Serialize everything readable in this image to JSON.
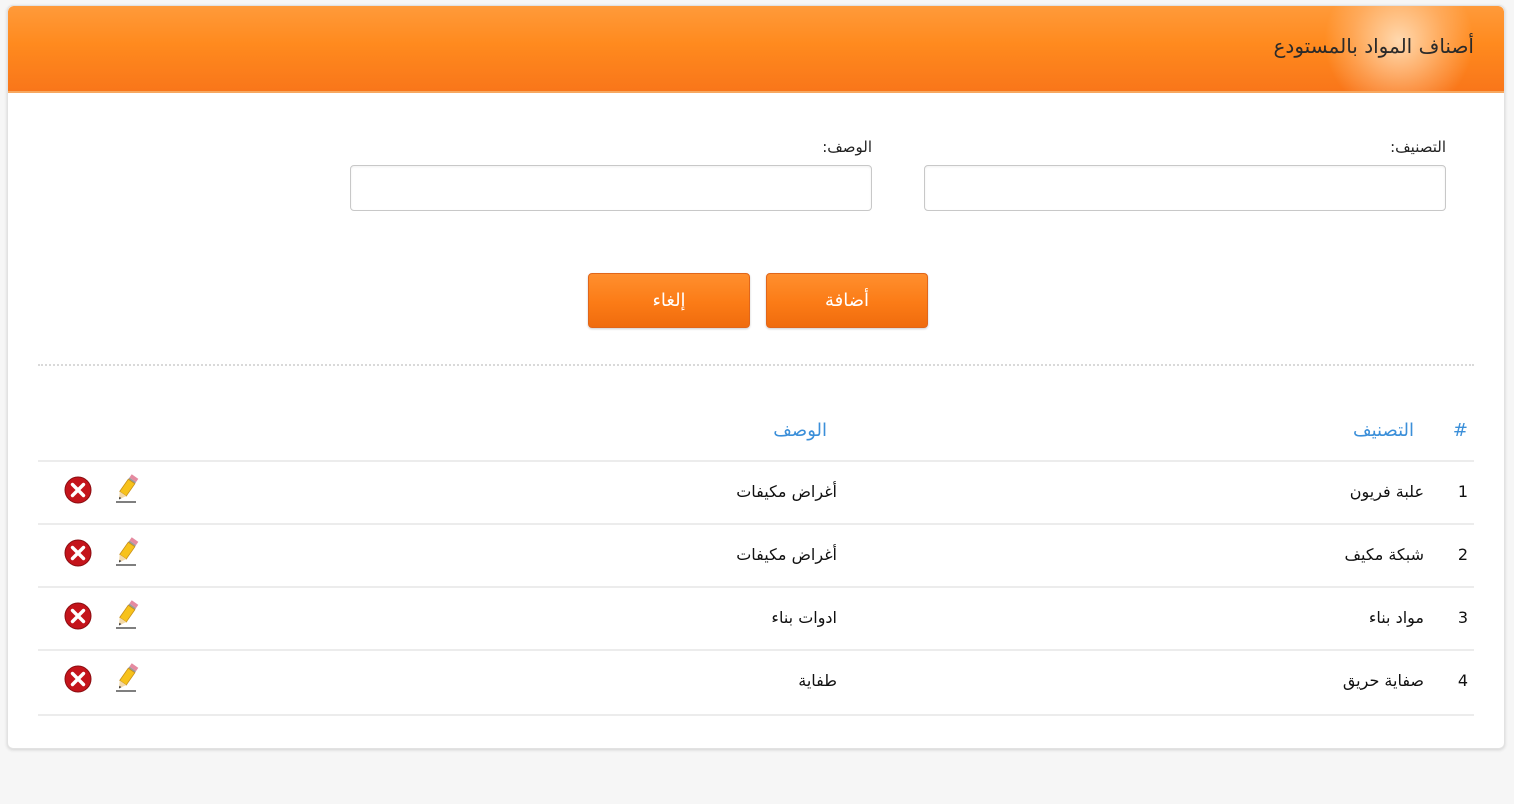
{
  "header": {
    "title": "أصناف المواد بالمستودع"
  },
  "form": {
    "category_label": "التصنيف:",
    "category_value": "",
    "description_label": "الوصف:",
    "description_value": "",
    "add_label": "أضافة",
    "cancel_label": "إلغاء"
  },
  "table": {
    "headers": {
      "number": "#",
      "category": "التصنيف",
      "description": "الوصف"
    },
    "rows": [
      {
        "number": "1",
        "category": "علبة فريون",
        "description": "أغراض مكيفات"
      },
      {
        "number": "2",
        "category": "شبكة مكيف",
        "description": "أغراض مكيفات"
      },
      {
        "number": "3",
        "category": "مواد بناء",
        "description": "ادوات بناء"
      },
      {
        "number": "4",
        "category": "صفاية حريق",
        "description": "طفاية"
      }
    ]
  },
  "icons": {
    "edit": "pencil-icon",
    "delete": "delete-icon"
  },
  "colors": {
    "header_orange": "#ff8a1e",
    "button_orange": "#fb7b16",
    "link_blue": "#3b8fd9",
    "delete_red": "#c4141b"
  }
}
